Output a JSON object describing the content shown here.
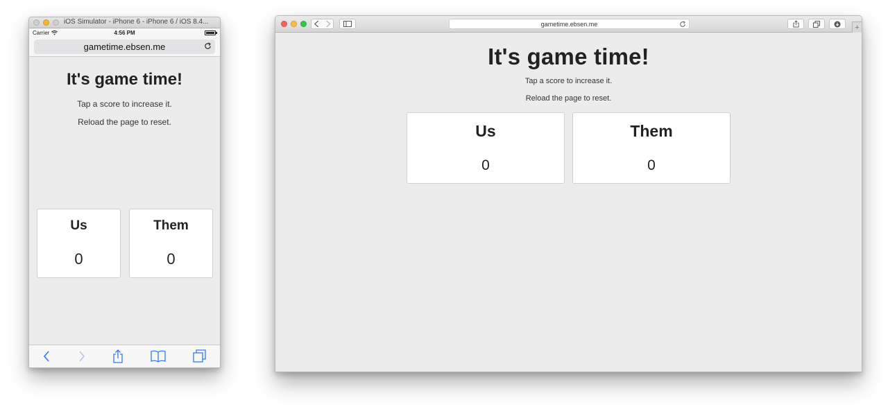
{
  "simulator": {
    "window_title": "iOS Simulator - iPhone 6 - iPhone 6 / iOS 8.4...",
    "status_bar": {
      "carrier": "Carrier",
      "time": "4:56 PM"
    },
    "url": "gametime.ebsen.me",
    "toolbar_icons": [
      "back-icon",
      "forward-icon",
      "share-icon",
      "bookmarks-icon",
      "tabs-icon"
    ]
  },
  "safari": {
    "url": "gametime.ebsen.me",
    "toolbar_icons": [
      "back-icon",
      "forward-icon",
      "sidebar-icon",
      "reload-icon",
      "share-icon",
      "tabs-overview-icon",
      "downloads-icon",
      "new-tab-icon"
    ]
  },
  "page": {
    "heading": "It's game time!",
    "instruction_tap": "Tap a score to increase it.",
    "instruction_reload": "Reload the page to reset.",
    "teams": [
      {
        "name": "Us",
        "score": "0"
      },
      {
        "name": "Them",
        "score": "0"
      }
    ]
  },
  "colors": {
    "ios_accent": "#3478f6",
    "page_background": "#ececec",
    "card_background": "#ffffff",
    "close_red": "#fc605c",
    "minimize_yellow": "#fdbc40",
    "zoom_green": "#34c84a"
  }
}
